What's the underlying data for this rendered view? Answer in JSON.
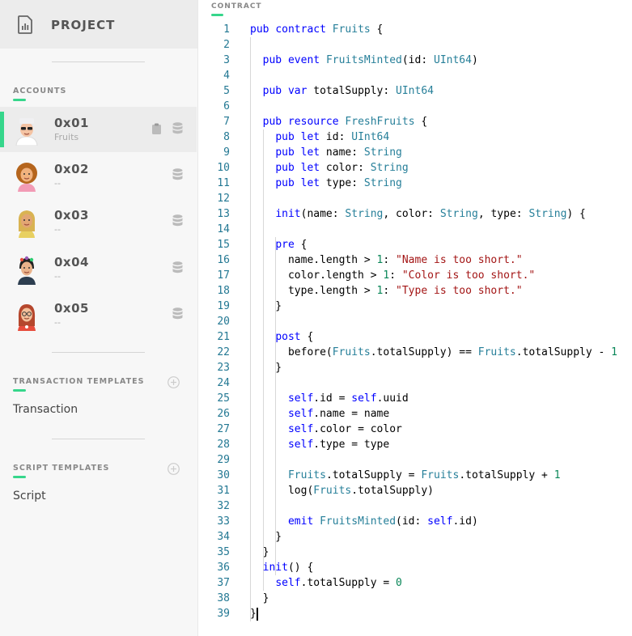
{
  "sidebar": {
    "project_label": "PROJECT",
    "accounts_title": "ACCOUNTS",
    "accounts": [
      {
        "address": "0x01",
        "subtitle": "Fruits",
        "avatar": "avatar-sunglasses",
        "active": true
      },
      {
        "address": "0x02",
        "subtitle": "--",
        "avatar": "avatar-curly-hair",
        "active": false
      },
      {
        "address": "0x03",
        "subtitle": "--",
        "avatar": "avatar-blonde",
        "active": false
      },
      {
        "address": "0x04",
        "subtitle": "--",
        "avatar": "avatar-flower-crown",
        "active": false
      },
      {
        "address": "0x05",
        "subtitle": "--",
        "avatar": "avatar-red-hair-glasses",
        "active": false
      }
    ],
    "transaction_templates_title": "TRANSACTION TEMPLATES",
    "transaction_item": "Transaction",
    "script_templates_title": "SCRIPT TEMPLATES",
    "script_item": "Script"
  },
  "editor": {
    "section_label": "CONTRACT",
    "line_numbers": [
      "1",
      "2",
      "3",
      "4",
      "5",
      "6",
      "7",
      "8",
      "9",
      "10",
      "11",
      "12",
      "13",
      "14",
      "15",
      "16",
      "17",
      "18",
      "19",
      "20",
      "21",
      "22",
      "23",
      "24",
      "25",
      "26",
      "27",
      "28",
      "29",
      "30",
      "31",
      "32",
      "33",
      "34",
      "35",
      "36",
      "37",
      "38",
      "39"
    ],
    "lines": [
      "pub contract Fruits {",
      "",
      "  pub event FruitsMinted(id: UInt64)",
      "",
      "  pub var totalSupply: UInt64",
      "",
      "  pub resource FreshFruits {",
      "    pub let id: UInt64",
      "    pub let name: String",
      "    pub let color: String",
      "    pub let type: String",
      "",
      "    init(name: String, color: String, type: String) {",
      "",
      "    pre {",
      "      name.length > 1: \"Name is too short.\"",
      "      color.length > 1: \"Color is too short.\"",
      "      type.length > 1: \"Type is too short.\"",
      "    }",
      "",
      "    post {",
      "      before(Fruits.totalSupply) == Fruits.totalSupply - 1",
      "    }",
      "",
      "      self.id = self.uuid",
      "      self.name = name",
      "      self.color = color",
      "      self.type = type",
      "",
      "      Fruits.totalSupply = Fruits.totalSupply + 1",
      "      log(Fruits.totalSupply)",
      "",
      "      emit FruitsMinted(id: self.id)",
      "    }",
      "  }",
      "  init() {",
      "    self.totalSupply = 0",
      "  }",
      "}"
    ]
  },
  "colors": {
    "accent": "#36d68b",
    "keyword": "#0000ff",
    "type": "#267f99",
    "string": "#a31515",
    "number": "#098658",
    "line_number": "#237893"
  }
}
